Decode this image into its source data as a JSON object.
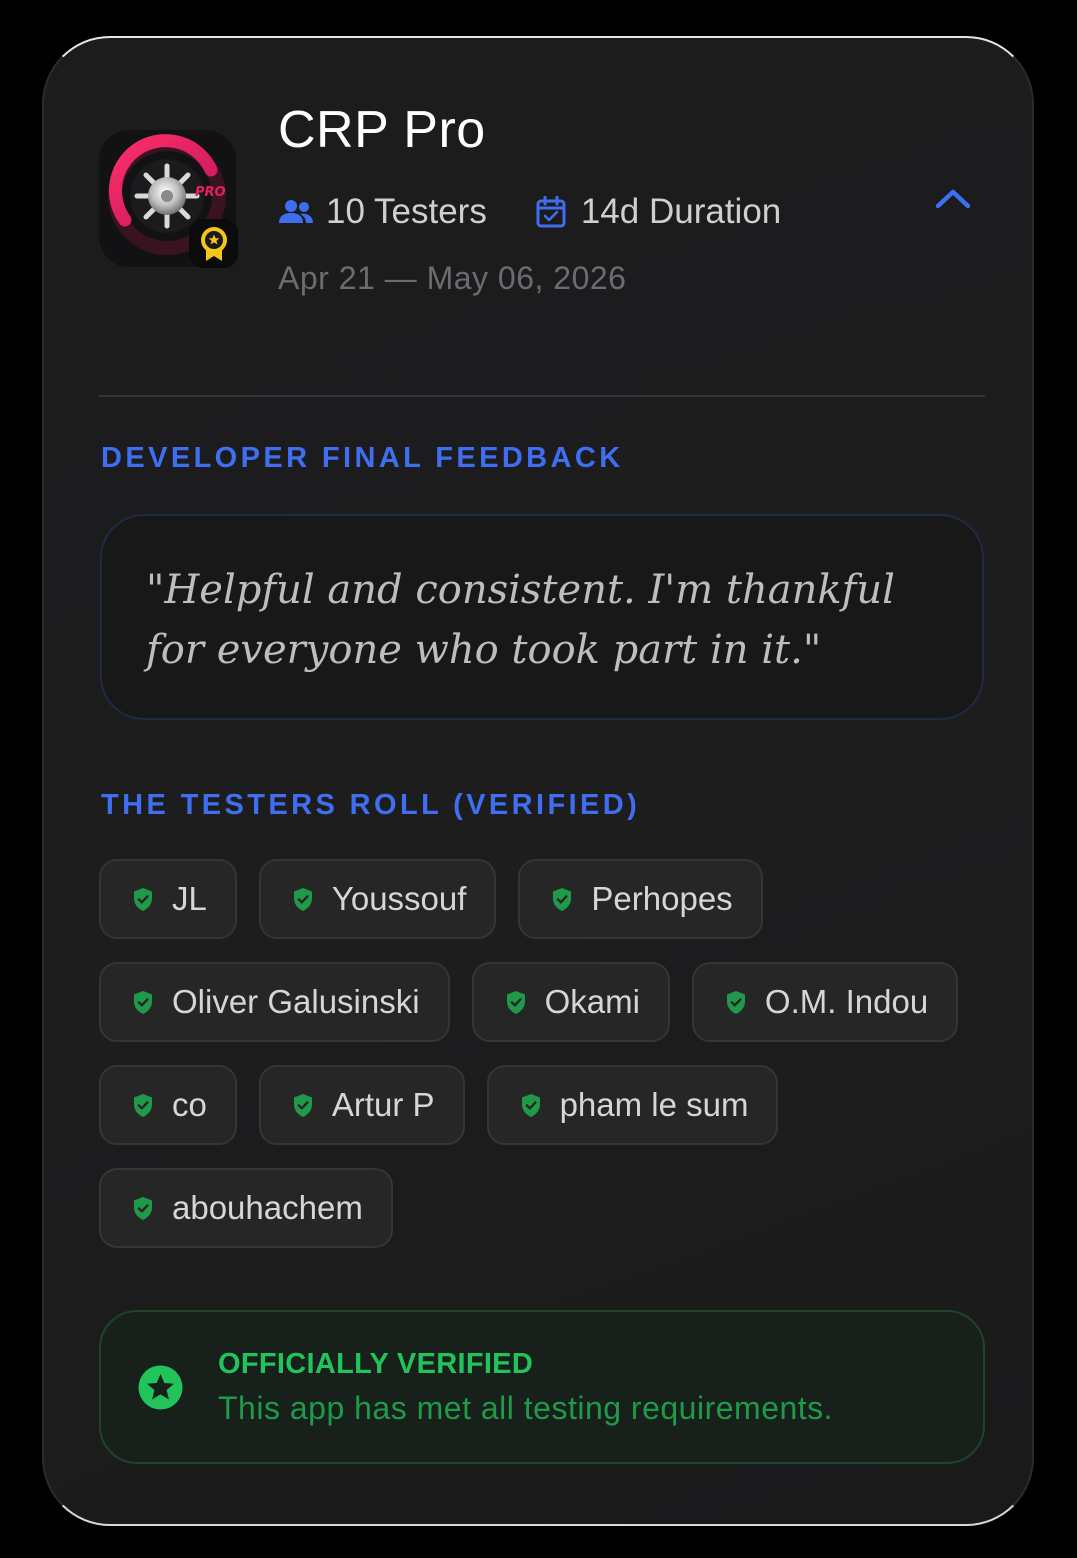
{
  "app": {
    "name": "CRP Pro",
    "icon_name": "vault-dial-icon",
    "badge_icon": "award-ribbon-icon"
  },
  "meta": {
    "testers": "10 Testers",
    "duration": "14d Duration",
    "dates": "Apr 21 — May 06, 2026",
    "testers_icon": "users-icon",
    "duration_icon": "calendar-check-icon",
    "collapse_icon": "chevron-up-icon"
  },
  "feedback": {
    "label": "DEVELOPER FINAL FEEDBACK",
    "quote": "\"Helpful and consistent. I'm thankful for everyone who took part in it.\""
  },
  "testers": {
    "label": "THE TESTERS ROLL (VERIFIED)",
    "rows": [
      [
        "JL",
        "Youssouf",
        "Perhopes"
      ],
      [
        "Oliver Galusinski",
        "Okami",
        "O.M. Indou"
      ],
      [
        "co",
        "Artur P",
        "pham le sum"
      ],
      [
        "abouhachem"
      ]
    ]
  },
  "verified": {
    "title": "OFFICIALLY VERIFIED",
    "subtitle": "This app has met all testing requirements.",
    "icon": "star-badge-icon"
  },
  "colors": {
    "accent_blue": "#3f6ef0",
    "verified_green": "#21c45a",
    "shield_green": "#1f9a48",
    "background": "#1c1c1d",
    "gold": "#f5c518"
  }
}
